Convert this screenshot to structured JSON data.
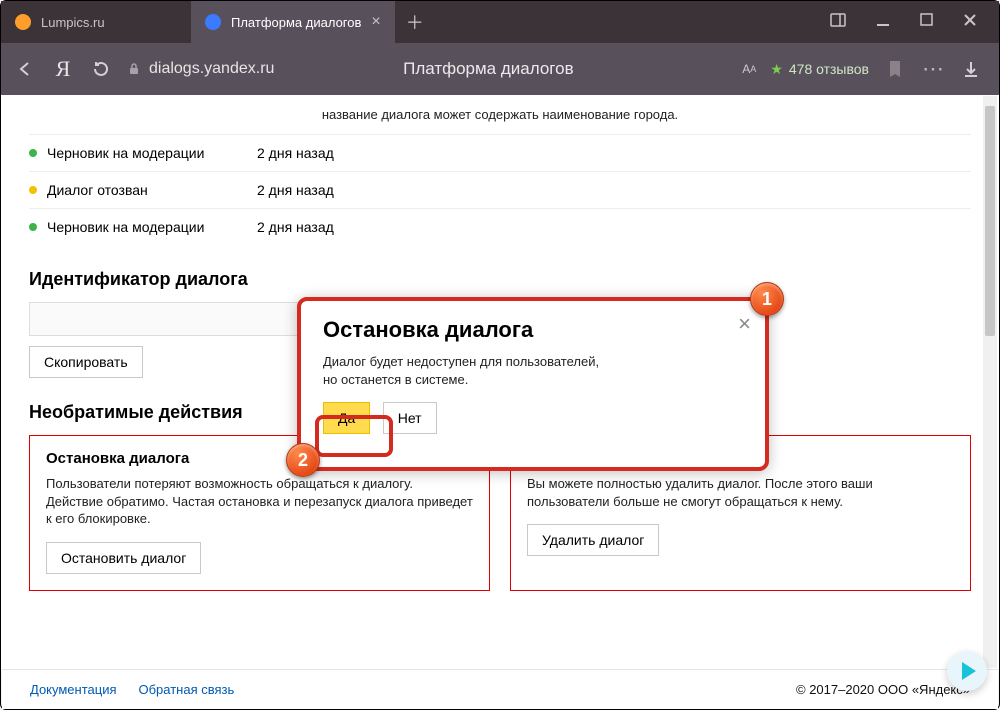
{
  "tabs": [
    {
      "title": "Lumpics.ru",
      "favicon_color": "#ff9e2c",
      "active": false
    },
    {
      "title": "Платформа диалогов",
      "favicon_color": "#3b7bff",
      "active": true
    }
  ],
  "toolbar": {
    "url_host": "dialogs.yandex.ru",
    "page_title": "Платформа диалогов",
    "reviews_text": "478 отзывов",
    "text_size_label": "A",
    "text_size_sub": "А"
  },
  "top_snippet": "название диалога может содержать наименование города.",
  "status_rows": [
    {
      "color": "green",
      "label": "Черновик на модерации",
      "time": "2 дня назад"
    },
    {
      "color": "yellow",
      "label": "Диалог отозван",
      "time": "2 дня назад"
    },
    {
      "color": "green",
      "label": "Черновик на модерации",
      "time": "2 дня назад"
    }
  ],
  "section_id_title": "Идентификатор диалога",
  "copy_label": "Скопировать",
  "section_irrev_title": "Необратимые действия",
  "cards": {
    "stop": {
      "title": "Остановка диалога",
      "text": "Пользователи потеряют возможность обращаться к диалогу. Действие обратимо. Частая остановка и перезапуск диалога приведет к его блокировке.",
      "button": "Остановить диалог"
    },
    "delete": {
      "text": "Вы можете полностью удалить диалог. После этого ваши пользователи больше не смогут обращаться к нему.",
      "button": "Удалить диалог"
    }
  },
  "modal": {
    "title": "Остановка диалога",
    "text_line1": "Диалог будет недоступен для пользователей,",
    "text_line2": "но останется в системе.",
    "yes": "Да",
    "no": "Нет"
  },
  "footer": {
    "doc": "Документация",
    "feedback": "Обратная связь",
    "copyright": "© 2017–2020  ООО «Яндекс»"
  },
  "callouts": {
    "one": "1",
    "two": "2"
  }
}
